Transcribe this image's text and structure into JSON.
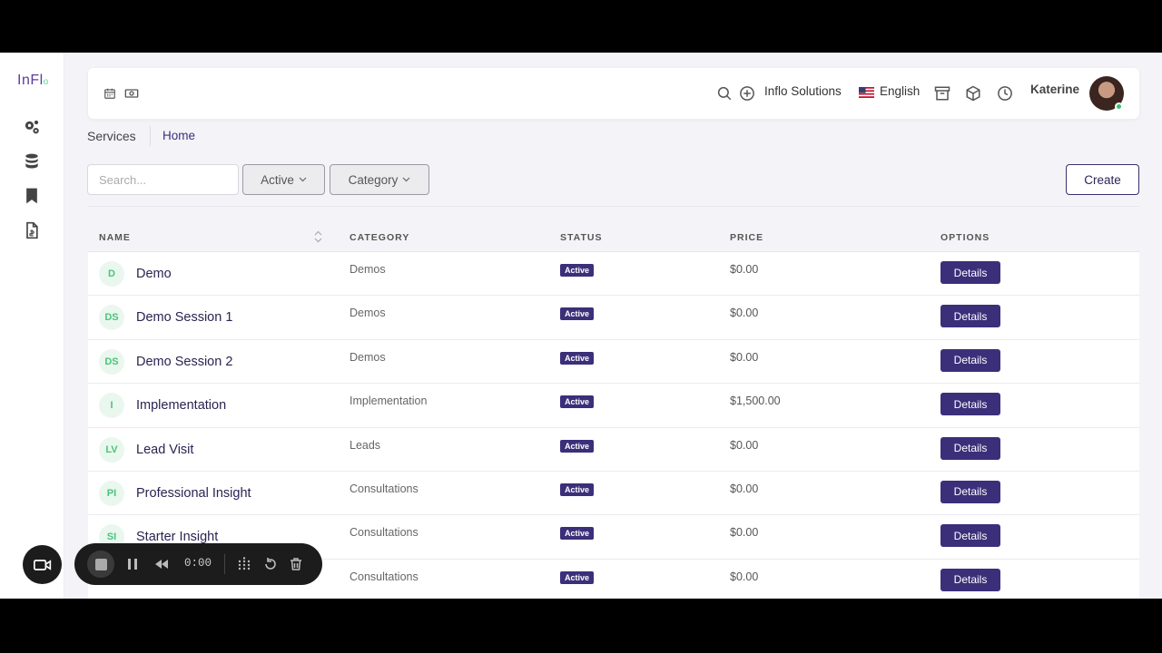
{
  "app": {
    "logo": "InFl",
    "logo_dot": "o"
  },
  "sidebar": {
    "items": [
      {
        "icon": "gears-icon"
      },
      {
        "icon": "database-icon"
      },
      {
        "icon": "bookmark-icon"
      },
      {
        "icon": "file-invoice-icon"
      }
    ]
  },
  "topbar": {
    "company": "Inflo Solutions",
    "language": "English",
    "user": "Katerine"
  },
  "breadcrumb": {
    "section": "Services",
    "home": "Home"
  },
  "filters": {
    "search_placeholder": "Search...",
    "active_label": "Active",
    "category_label": "Category",
    "create_label": "Create"
  },
  "table": {
    "headers": {
      "name": "NAME",
      "category": "CATEGORY",
      "status": "STATUS",
      "price": "PRICE",
      "options": "OPTIONS"
    },
    "details_label": "Details",
    "rows": [
      {
        "initials": "D",
        "name": "Demo",
        "category": "Demos",
        "status": "Active",
        "price": "$0.00"
      },
      {
        "initials": "DS",
        "name": "Demo Session 1",
        "category": "Demos",
        "status": "Active",
        "price": "$0.00"
      },
      {
        "initials": "DS",
        "name": "Demo Session 2",
        "category": "Demos",
        "status": "Active",
        "price": "$0.00"
      },
      {
        "initials": "I",
        "name": "Implementation",
        "category": "Implementation",
        "status": "Active",
        "price": "$1,500.00"
      },
      {
        "initials": "LV",
        "name": "Lead Visit",
        "category": "Leads",
        "status": "Active",
        "price": "$0.00"
      },
      {
        "initials": "PI",
        "name": "Professional Insight",
        "category": "Consultations",
        "status": "Active",
        "price": "$0.00"
      },
      {
        "initials": "SI",
        "name": "Starter Insight",
        "category": "Consultations",
        "status": "Active",
        "price": "$0.00"
      },
      {
        "initials": "",
        "name": "",
        "category": "Consultations",
        "status": "Active",
        "price": "$0.00"
      }
    ]
  },
  "recorder": {
    "time": "0:00"
  },
  "colors": {
    "accent": "#3b2f7a",
    "initials_green": "#4cc47a",
    "online": "#38c172"
  }
}
